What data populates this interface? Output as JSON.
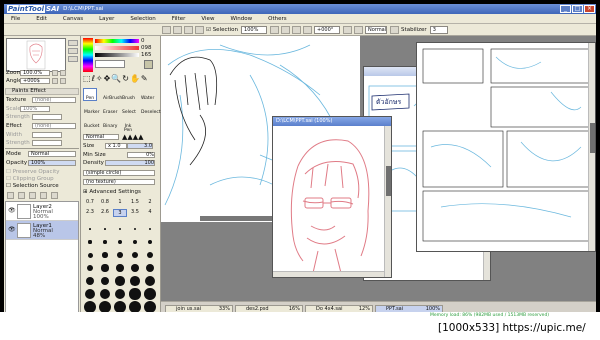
{
  "app": {
    "logo_a": "PaintTool",
    "logo_b": "SAI",
    "title": "D:\\LCM\\PPT.sai"
  },
  "menu": [
    "File",
    "Edit",
    "Canvas",
    "Layer",
    "Selection",
    "Filter",
    "View",
    "Window",
    "Others"
  ],
  "toolbar": {
    "selection_label": "Selection",
    "angle_value": "+000°",
    "mode_value": "Normal",
    "stabilizer_label": "Stabilizer",
    "stabilizer_value": "3",
    "zoom_value": "100%"
  },
  "navigator": {
    "zoom_label": "Zoom",
    "zoom_value": "100.0%",
    "angle_label": "Angle",
    "angle_value": "+000$"
  },
  "paper_effect": {
    "title": "Paints Effect",
    "texture_label": "Texture",
    "texture_value": "(none)",
    "scale_label": "Scale",
    "scale_value": "100%",
    "strength_label": "Strength",
    "effect_label": "Effect",
    "effect_value": "(none)",
    "width_label": "Width",
    "strength2_label": "Strength"
  },
  "layer_panel": {
    "mode_label": "Mode",
    "mode_value": "Normal",
    "opacity_label": "Opacity",
    "opacity_value": "100%",
    "preserve_label": "Preserve Opacity",
    "clipping_label": "Clipping Group",
    "selection_source_label": "Selection Source",
    "layers": [
      {
        "name": "Layer2",
        "mode": "Normal",
        "opacity": "100%"
      },
      {
        "name": "Layer1",
        "mode": "Normal",
        "opacity": "48%"
      }
    ]
  },
  "color": {
    "val1": "0",
    "val2": "098",
    "val3": "165"
  },
  "tools": {
    "items": [
      "Pen",
      "AirBrush",
      "Brush",
      "Water",
      "Marker",
      "Eraser",
      "Select",
      "Deselect",
      "Bucket",
      "Binary",
      "Ink Pen",
      ""
    ],
    "active": "Pen",
    "blend_mode": "Normal",
    "size_label": "Size",
    "size_mult": "x 1.0",
    "size_value": "3.0",
    "min_size_label": "Min Size",
    "min_size_value": "0%",
    "density_label": "Density",
    "density_value": "100",
    "shape_value": "(simple circle)",
    "texture_value": "(no texture)",
    "advanced_label": "Advanced Settings",
    "brush_sizes": [
      "0.7",
      "0.8",
      "1",
      "1.5",
      "2",
      "2.3",
      "2.6",
      "3",
      "3.5",
      "4"
    ]
  },
  "canvas_windows": [
    {
      "title": "D:\\LCM\\PPT.sai (100%)"
    },
    {
      "title": ""
    }
  ],
  "tabs": [
    {
      "name": "join us.sai",
      "pct": "33%"
    },
    {
      "name": "des2.psd",
      "pct": "16%"
    },
    {
      "name": "Do 4x4.sai",
      "pct": "12%"
    },
    {
      "name": "PPT.sai",
      "pct": "100%"
    }
  ],
  "status": {
    "memory": "Memory load: 86% (982MB used / 1513MB reserved)"
  },
  "watermark": "[1000x533] https://upic.me/"
}
